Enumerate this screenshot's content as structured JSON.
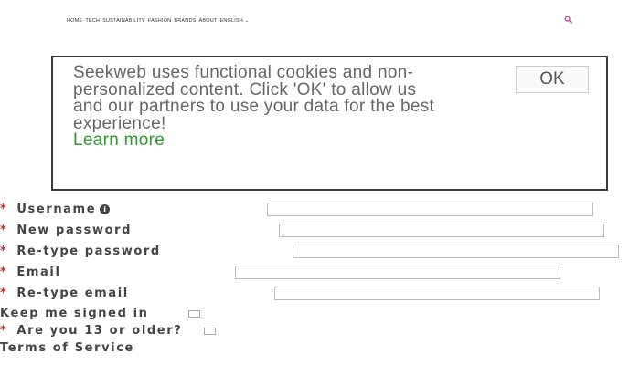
{
  "nav": {
    "items": [
      "HOME",
      "TECH",
      "SUSTAINABILITY",
      "FASHION",
      "BRANDS",
      "ABOUT",
      "ENGLISH"
    ]
  },
  "cookie_banner": {
    "text": "Seekweb uses functional cookies and non-personalized content. Click 'OK' to allow us and our partners to use your data for the best experience!",
    "link": "Learn more",
    "ok_label": "OK"
  },
  "form": {
    "username_label": "Username",
    "new_password_label": "New password",
    "retype_password_label": "Re-type password",
    "email_label": "Email",
    "retype_email_label": "Re-type email",
    "keep_signed_in_label": "Keep me signed in",
    "age_label": "Are you 13 or older?",
    "terms_label": "Terms of Service",
    "required_mark": "*"
  },
  "colors": {
    "accent": "#c040a0",
    "link": "#2e9a2e",
    "required": "#c03030"
  },
  "icons": {
    "search": "search-icon",
    "info": "info-icon",
    "chevron": "chevron-down-icon"
  }
}
